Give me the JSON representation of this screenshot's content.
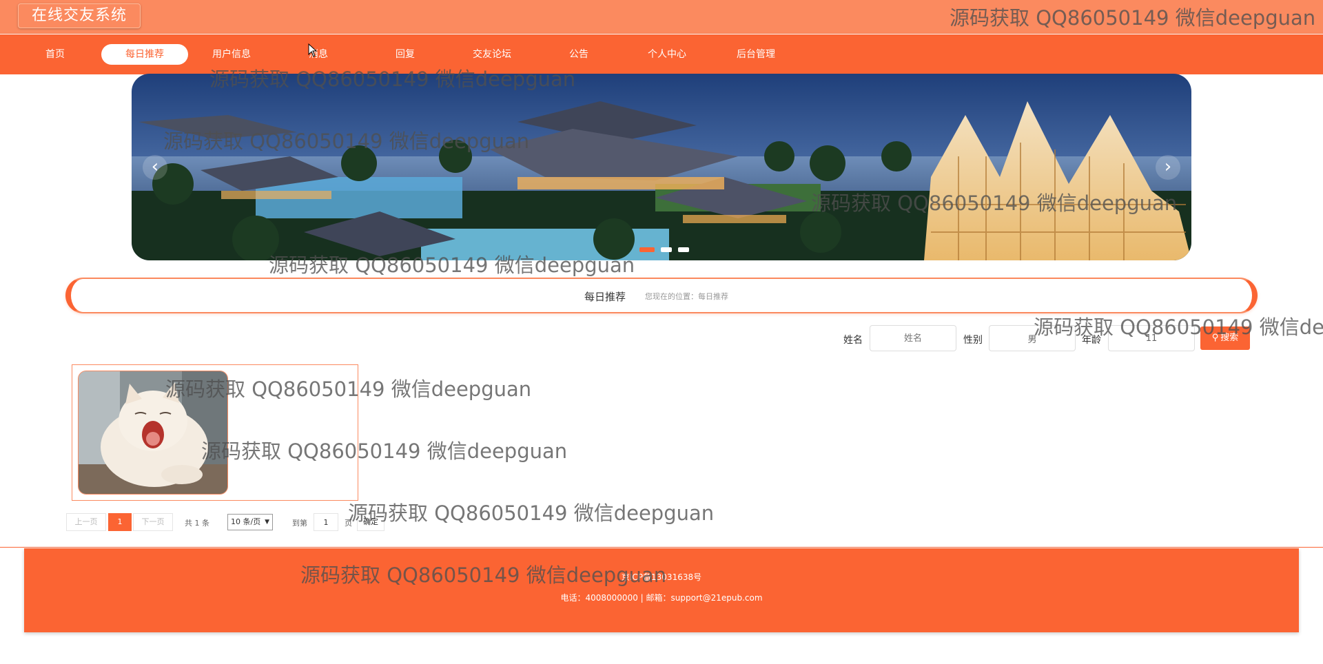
{
  "header": {
    "title": "在线交友系统",
    "watermark": "源码获取 QQ86050149 微信deepguan"
  },
  "nav": {
    "items": [
      {
        "label": "首页",
        "active": false
      },
      {
        "label": "每日推荐",
        "active": true
      },
      {
        "label": "用户信息",
        "active": false
      },
      {
        "label": "消息",
        "active": false
      },
      {
        "label": "回复",
        "active": false
      },
      {
        "label": "交友论坛",
        "active": false
      },
      {
        "label": "公告",
        "active": false
      },
      {
        "label": "个人中心",
        "active": false
      },
      {
        "label": "后台管理",
        "active": false
      }
    ]
  },
  "banner": {
    "prev_icon": "chevron-left-icon",
    "next_icon": "chevron-right-icon",
    "slide_count": 3,
    "active_slide": 1
  },
  "breadcrumb": {
    "title": "每日推荐",
    "path": "您现在的位置：每日推荐"
  },
  "search": {
    "name_label": "姓名",
    "name_placeholder": "姓名",
    "gender_label": "性别",
    "gender_value": "男",
    "age_label": "年龄",
    "age_value": "11",
    "button_label": "搜索",
    "button_icon": "search-icon"
  },
  "pagination": {
    "prev_label": "上一页",
    "current_page": "1",
    "next_label": "下一页",
    "total_text": "共 1 条",
    "page_size": "10 条/页",
    "goto_label": "到第",
    "goto_value": "1",
    "page_unit": "页",
    "confirm_label": "确定"
  },
  "footer": {
    "icp": "京ICP备13031638号",
    "contact": "电话：4008000000 | 邮箱：support@21epub.com"
  },
  "colors": {
    "primary": "#fb6433",
    "header_bg": "#fb8a5f"
  }
}
